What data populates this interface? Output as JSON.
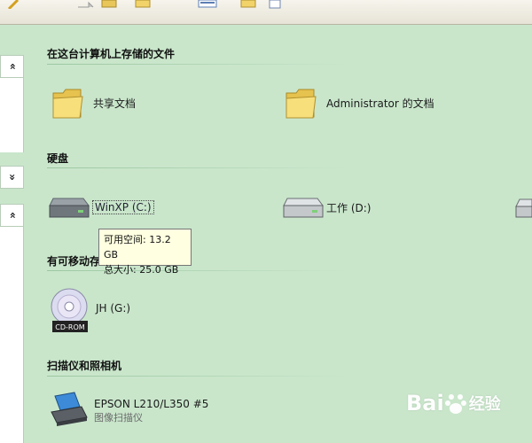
{
  "colors": {
    "background": "#c9e6cb",
    "tooltip_bg": "#ffffe1"
  },
  "pane": {
    "collapse_up_1": "»",
    "collapse_down": "»",
    "collapse_up_2": "»"
  },
  "sections": {
    "stored_files": {
      "title": "在这台计算机上存储的文件",
      "items": [
        {
          "label": "共享文档",
          "icon": "folder-icon"
        },
        {
          "label": "Administrator 的文档",
          "icon": "folder-icon"
        }
      ]
    },
    "hard_drives": {
      "title": "硬盘",
      "items": [
        {
          "label": "WinXP (C:)",
          "icon": "hard-drive-icon"
        },
        {
          "label": "工作 (D:)",
          "icon": "hard-drive-icon"
        }
      ]
    },
    "removable": {
      "title": "有可移动存",
      "items": [
        {
          "label": "JH (G:)",
          "icon": "cd-rom-icon",
          "icon_text": "CD-ROM"
        }
      ]
    },
    "scanners": {
      "title": "扫描仪和照相机",
      "items": [
        {
          "label": "EPSON L210/L350 #5",
          "sublabel": "图像扫描仪",
          "icon": "scanner-icon"
        }
      ]
    }
  },
  "tooltip": {
    "line1": "可用空间: 13.2 GB",
    "line2": "总大小: 25.0 GB"
  },
  "watermark": {
    "text1": "Bai",
    "text2": "经验"
  }
}
